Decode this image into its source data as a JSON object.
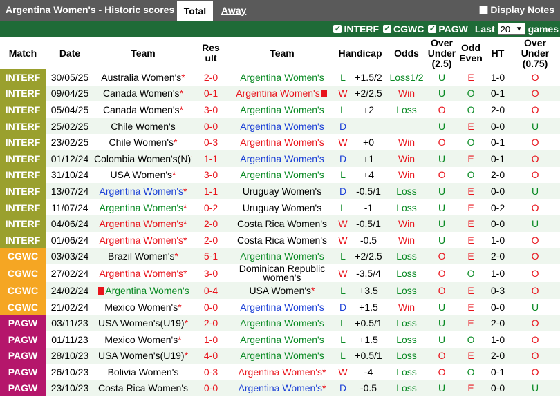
{
  "header": {
    "title": "Argentina Women's - Historic scores",
    "tab_total": "Total",
    "tab_away": "Away",
    "display_notes": "Display Notes"
  },
  "filters": {
    "items": [
      "INTERF",
      "CGWC",
      "PAGW"
    ],
    "last_label": "Last",
    "last_value": "20",
    "games_label": "games"
  },
  "colors": {
    "INTERF": "#9aa02e",
    "CGWC": "#f5a623",
    "PAGW": "#b5166b"
  },
  "columns": [
    "Match",
    "Date",
    "Team",
    "Result",
    "Team",
    "Handicap",
    "Odds",
    "Over Under (2.5)",
    "Odd Even",
    "HT",
    "Over Under (0.75)"
  ],
  "rows": [
    {
      "league": "INTERF",
      "date": "30/05/25",
      "home": "Australia Women's",
      "hs": true,
      "hc": "black",
      "score": "2-0",
      "away": "Argentina Women's",
      "as": false,
      "ac": "green",
      "res": "L",
      "hcap": "+1.5/2",
      "odds": "Loss1/2",
      "ou": "U",
      "oe": "E",
      "ht": "1-0",
      "ou2": "O"
    },
    {
      "league": "INTERF",
      "date": "09/04/25",
      "home": "Canada Women's",
      "hs": true,
      "hc": "black",
      "score": "0-1",
      "away": "Argentina Women's",
      "as": false,
      "af": true,
      "ac": "red",
      "res": "W",
      "hcap": "+2/2.5",
      "odds": "Win",
      "ou": "U",
      "oe": "O",
      "ht": "0-1",
      "ou2": "O"
    },
    {
      "league": "INTERF",
      "date": "05/04/25",
      "home": "Canada Women's",
      "hs": true,
      "hc": "black",
      "score": "3-0",
      "away": "Argentina Women's",
      "as": false,
      "ac": "green",
      "res": "L",
      "hcap": "+2",
      "odds": "Loss",
      "ou": "O",
      "oe": "O",
      "ht": "2-0",
      "ou2": "O"
    },
    {
      "league": "INTERF",
      "date": "25/02/25",
      "home": "Chile Women's",
      "hs": false,
      "hc": "black",
      "score": "0-0",
      "away": "Argentina Women's",
      "as": false,
      "ac": "blue",
      "res": "D",
      "hcap": "",
      "odds": "",
      "ou": "U",
      "oe": "E",
      "ht": "0-0",
      "ou2": "U"
    },
    {
      "league": "INTERF",
      "date": "23/02/25",
      "home": "Chile Women's",
      "hs": true,
      "hc": "black",
      "score": "0-3",
      "away": "Argentina Women's",
      "as": false,
      "ac": "red",
      "res": "W",
      "hcap": "+0",
      "odds": "Win",
      "ou": "O",
      "oe": "O",
      "ht": "0-1",
      "ou2": "O"
    },
    {
      "league": "INTERF",
      "date": "01/12/24",
      "home": "Colombia Women's(N)",
      "hs": true,
      "hc": "black",
      "score": "1-1",
      "away": "Argentina Women's",
      "as": false,
      "ac": "blue",
      "res": "D",
      "hcap": "+1",
      "odds": "Win",
      "ou": "U",
      "oe": "E",
      "ht": "0-1",
      "ou2": "O"
    },
    {
      "league": "INTERF",
      "date": "31/10/24",
      "home": "USA Women's",
      "hs": true,
      "hc": "black",
      "score": "3-0",
      "away": "Argentina Women's",
      "as": false,
      "ac": "green",
      "res": "L",
      "hcap": "+4",
      "odds": "Win",
      "ou": "O",
      "oe": "O",
      "ht": "2-0",
      "ou2": "O"
    },
    {
      "league": "INTERF",
      "date": "13/07/24",
      "home": "Argentina Women's",
      "hs": true,
      "hc": "blue",
      "score": "1-1",
      "away": "Uruguay Women's",
      "as": false,
      "ac": "black",
      "res": "D",
      "hcap": "-0.5/1",
      "odds": "Loss",
      "ou": "U",
      "oe": "E",
      "ht": "0-0",
      "ou2": "U"
    },
    {
      "league": "INTERF",
      "date": "11/07/24",
      "home": "Argentina Women's",
      "hs": true,
      "hc": "green",
      "score": "0-2",
      "away": "Uruguay Women's",
      "as": false,
      "ac": "black",
      "res": "L",
      "hcap": "-1",
      "odds": "Loss",
      "ou": "U",
      "oe": "E",
      "ht": "0-2",
      "ou2": "O"
    },
    {
      "league": "INTERF",
      "date": "04/06/24",
      "home": "Argentina Women's",
      "hs": true,
      "hc": "red",
      "score": "2-0",
      "away": "Costa Rica Women's",
      "as": false,
      "ac": "black",
      "res": "W",
      "hcap": "-0.5/1",
      "odds": "Win",
      "ou": "U",
      "oe": "E",
      "ht": "0-0",
      "ou2": "U"
    },
    {
      "league": "INTERF",
      "date": "01/06/24",
      "home": "Argentina Women's",
      "hs": true,
      "hc": "red",
      "score": "2-0",
      "away": "Costa Rica Women's",
      "as": false,
      "ac": "black",
      "res": "W",
      "hcap": "-0.5",
      "odds": "Win",
      "ou": "U",
      "oe": "E",
      "ht": "1-0",
      "ou2": "O"
    },
    {
      "league": "CGWC",
      "date": "03/03/24",
      "home": "Brazil Women's",
      "hs": true,
      "hc": "black",
      "score": "5-1",
      "away": "Argentina Women's",
      "as": false,
      "ac": "green",
      "res": "L",
      "hcap": "+2/2.5",
      "odds": "Loss",
      "ou": "O",
      "oe": "E",
      "ht": "2-0",
      "ou2": "O"
    },
    {
      "league": "CGWC",
      "date": "27/02/24",
      "home": "Argentina Women's",
      "hs": true,
      "hc": "red",
      "score": "3-0",
      "away": "Dominican Republic women's",
      "as": false,
      "ac": "black",
      "wrap": true,
      "res": "W",
      "hcap": "-3.5/4",
      "odds": "Loss",
      "ou": "O",
      "oe": "O",
      "ht": "1-0",
      "ou2": "O"
    },
    {
      "league": "CGWC",
      "date": "24/02/24",
      "home": "Argentina Women's",
      "hs": false,
      "hf": true,
      "hc": "green",
      "score": "0-4",
      "away": "USA Women's",
      "as": true,
      "ac": "black",
      "res": "L",
      "hcap": "+3.5",
      "odds": "Loss",
      "ou": "O",
      "oe": "E",
      "ht": "0-3",
      "ou2": "O"
    },
    {
      "league": "CGWC",
      "date": "21/02/24",
      "home": "Mexico Women's",
      "hs": true,
      "hc": "black",
      "score": "0-0",
      "away": "Argentina Women's",
      "as": false,
      "ac": "blue",
      "res": "D",
      "hcap": "+1.5",
      "odds": "Win",
      "ou": "U",
      "oe": "E",
      "ht": "0-0",
      "ou2": "U"
    },
    {
      "league": "PAGW",
      "date": "03/11/23",
      "home": "USA Women's(U19)",
      "hs": true,
      "hc": "black",
      "score": "2-0",
      "away": "Argentina Women's",
      "as": false,
      "ac": "green",
      "res": "L",
      "hcap": "+0.5/1",
      "odds": "Loss",
      "ou": "U",
      "oe": "E",
      "ht": "2-0",
      "ou2": "O"
    },
    {
      "league": "PAGW",
      "date": "01/11/23",
      "home": "Mexico Women's",
      "hs": true,
      "hc": "black",
      "score": "1-0",
      "away": "Argentina Women's",
      "as": false,
      "ac": "green",
      "res": "L",
      "hcap": "+1.5",
      "odds": "Loss",
      "ou": "U",
      "oe": "O",
      "ht": "1-0",
      "ou2": "O"
    },
    {
      "league": "PAGW",
      "date": "28/10/23",
      "home": "USA Women's(U19)",
      "hs": true,
      "hc": "black",
      "score": "4-0",
      "away": "Argentina Women's",
      "as": false,
      "ac": "green",
      "res": "L",
      "hcap": "+0.5/1",
      "odds": "Loss",
      "ou": "O",
      "oe": "E",
      "ht": "2-0",
      "ou2": "O"
    },
    {
      "league": "PAGW",
      "date": "26/10/23",
      "home": "Bolivia Women's",
      "hs": false,
      "hc": "black",
      "score": "0-3",
      "away": "Argentina Women's",
      "as": true,
      "ac": "red",
      "res": "W",
      "hcap": "-4",
      "odds": "Loss",
      "ou": "O",
      "oe": "O",
      "ht": "0-1",
      "ou2": "O"
    },
    {
      "league": "PAGW",
      "date": "23/10/23",
      "home": "Costa Rica Women's",
      "hs": false,
      "hc": "black",
      "score": "0-0",
      "away": "Argentina Women's",
      "as": true,
      "ac": "blue",
      "res": "D",
      "hcap": "-0.5",
      "odds": "Loss",
      "ou": "U",
      "oe": "E",
      "ht": "0-0",
      "ou2": "U"
    }
  ]
}
